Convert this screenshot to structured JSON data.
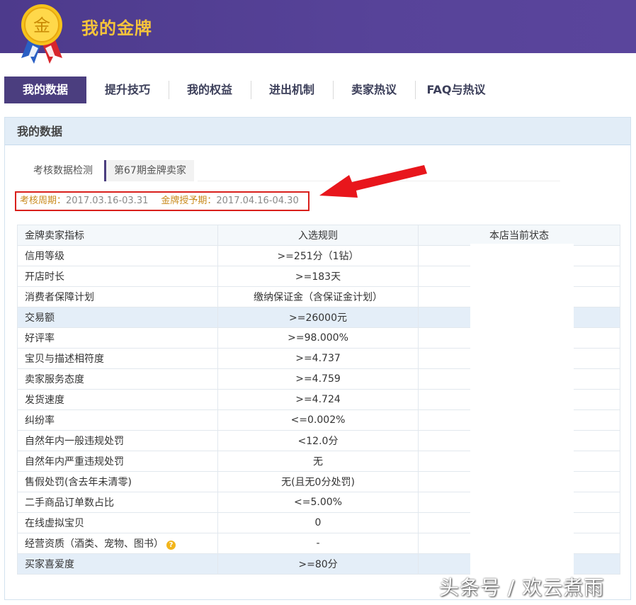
{
  "header": {
    "title": "我的金牌",
    "medal_char": "金"
  },
  "tabs": [
    {
      "label": "我的数据",
      "active": true
    },
    {
      "label": "提升技巧"
    },
    {
      "label": "我的权益"
    },
    {
      "label": "进出机制"
    },
    {
      "label": "卖家热议"
    },
    {
      "label": "FAQ与热议"
    }
  ],
  "panel": {
    "title": "我的数据",
    "subtabs": [
      {
        "label": "考核数据检测"
      },
      {
        "label": "第67期金牌卖家",
        "active": true
      }
    ],
    "period": {
      "assess_label": "考核周期：",
      "assess_value": "2017.03.16-03.31",
      "grant_label": "金牌授予期：",
      "grant_value": "2017.04.16-04.30"
    },
    "table": {
      "headers": [
        "金牌卖家指标",
        "入选规则",
        "本店当前状态"
      ],
      "rows": [
        {
          "indicator": "信用等级",
          "rule": ">=251分（1钻）",
          "status": ""
        },
        {
          "indicator": "开店时长",
          "rule": ">=183天",
          "status": ""
        },
        {
          "indicator": "消费者保障计划",
          "rule": "缴纳保证金（含保证金计划）",
          "status": ""
        },
        {
          "indicator": "交易额",
          "rule": ">=26000元",
          "status": ""
        },
        {
          "indicator": "好评率",
          "rule": ">=98.000%",
          "status": ""
        },
        {
          "indicator": "宝贝与描述相符度",
          "rule": ">=4.737",
          "status": ""
        },
        {
          "indicator": "卖家服务态度",
          "rule": ">=4.759",
          "status": ""
        },
        {
          "indicator": "发货速度",
          "rule": ">=4.724",
          "status": ""
        },
        {
          "indicator": "纠纷率",
          "rule": "<=0.002%",
          "status": ""
        },
        {
          "indicator": "自然年内一般违规处罚",
          "rule": "<12.0分",
          "status": ""
        },
        {
          "indicator": "自然年内严重违规处罚",
          "rule": "无",
          "status": ""
        },
        {
          "indicator": "售假处罚(含去年未清零)",
          "rule": "无(且无0分处罚)",
          "status": ""
        },
        {
          "indicator": "二手商品订单数占比",
          "rule": "<=5.00%",
          "status": ""
        },
        {
          "indicator": "在线虚拟宝贝",
          "rule": "0",
          "status": ""
        },
        {
          "indicator": "经营资质（酒类、宠物、图书）",
          "rule": "-",
          "status": ""
        },
        {
          "indicator": "买家喜爱度",
          "rule": ">=80分",
          "status": ""
        }
      ]
    }
  },
  "watermark": "头条号 / 欢云煮雨",
  "colors": {
    "header_bg": "#4d3a8c",
    "title_gold": "#f5c33b",
    "active_tab": "#4b3e7f",
    "highlight_box": "#d9201c",
    "row_highlight": "#e4eef8"
  },
  "icons": [
    "gold-medal-icon",
    "red-arrow-icon",
    "question-icon"
  ]
}
